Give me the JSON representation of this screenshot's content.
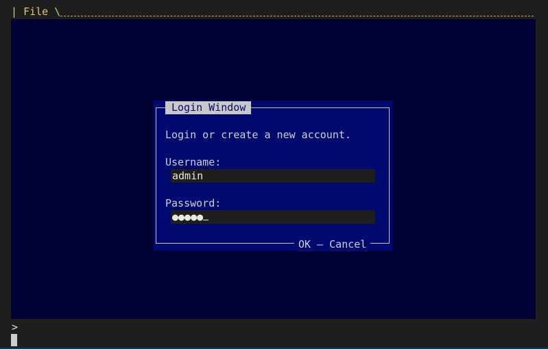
{
  "menubar": {
    "bar": "|",
    "file_label": "File",
    "separator": "\\"
  },
  "dialog": {
    "title": "Login Window",
    "message": "Login or create a new account.",
    "username_label": "Username:",
    "username_value": "admin",
    "password_label": "Password:",
    "password_mask": "●●●●●",
    "ok_label": "OK",
    "button_separator": "—",
    "cancel_label": "Cancel"
  },
  "terminal": {
    "prompt_symbol": ">"
  },
  "colors": {
    "screen_bg": "#000033",
    "dialog_bg": "#000a6e",
    "menubar_fg": "#e5c07b",
    "title_bg": "#c8c8c8"
  }
}
